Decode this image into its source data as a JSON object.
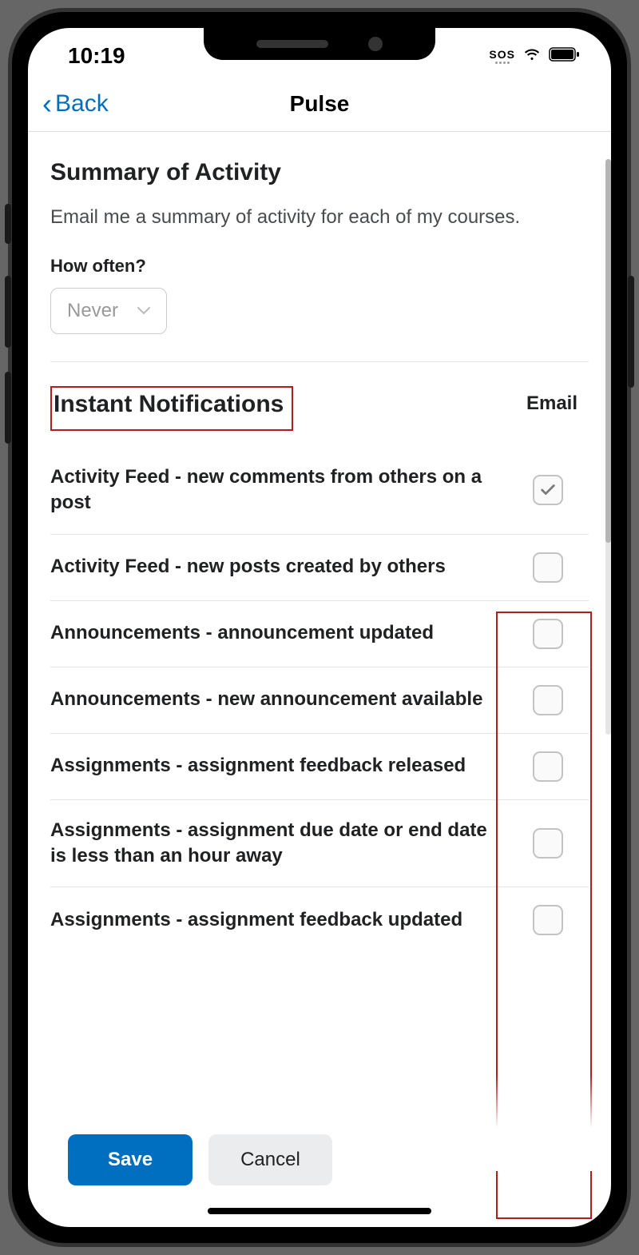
{
  "status": {
    "time": "10:19",
    "network": "SOS"
  },
  "header": {
    "back_label": "Back",
    "title": "Pulse"
  },
  "summary": {
    "title": "Summary of Activity",
    "desc": "Email me a summary of activity for each of my courses.",
    "frequency_label": "How often?",
    "frequency_value": "Never"
  },
  "instant": {
    "title": "Instant Notifications",
    "col_email": "Email",
    "rows": [
      {
        "label": "Activity Feed - new comments from others on a post",
        "checked": true
      },
      {
        "label": "Activity Feed - new posts created by others",
        "checked": false
      },
      {
        "label": "Announcements - announcement updated",
        "checked": false
      },
      {
        "label": "Announcements - new announcement available",
        "checked": false
      },
      {
        "label": "Assignments - assignment feedback released",
        "checked": false
      },
      {
        "label": "Assignments - assignment due date or end date is less than an hour away",
        "checked": false
      },
      {
        "label": "Assignments - assignment feedback updated",
        "checked": false
      }
    ]
  },
  "buttons": {
    "save": "Save",
    "cancel": "Cancel"
  }
}
